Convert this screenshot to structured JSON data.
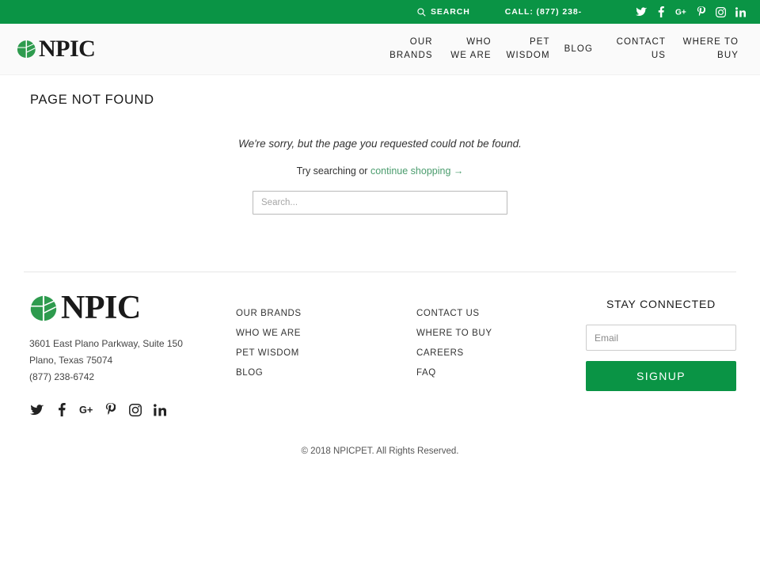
{
  "topbar": {
    "search_label": "SEARCH",
    "phone_label": "CALL: (877) 238-",
    "social": [
      {
        "name": "twitter-icon",
        "label": "Twitter"
      },
      {
        "name": "facebook-icon",
        "label": "Facebook"
      },
      {
        "name": "google-plus-icon",
        "label": "Google Plus"
      },
      {
        "name": "pinterest-icon",
        "label": "Pinterest"
      },
      {
        "name": "instagram-icon",
        "label": "Instagram"
      },
      {
        "name": "linkedin-icon",
        "label": "LinkedIn"
      }
    ]
  },
  "header": {
    "logo_text": "NPIC",
    "nav": [
      {
        "label": "OUR BRANDS"
      },
      {
        "label": "WHO WE ARE"
      },
      {
        "label": "PET WISDOM"
      },
      {
        "label": "BLOG"
      },
      {
        "label": "CONTACT US"
      },
      {
        "label": "WHERE TO BUY"
      }
    ]
  },
  "main": {
    "page_title": "PAGE NOT FOUND",
    "message": "We're sorry, but the page you requested could not be found.",
    "try_prefix": "Try searching or ",
    "continue_link": "continue shopping →",
    "search_placeholder": "Search...",
    "search_value": ""
  },
  "footer": {
    "logo_text": "NPIC",
    "address_line1": "3601 East Plano Parkway, Suite 150",
    "address_line2": "Plano, Texas 75074",
    "phone": "(877) 238-6742",
    "links_col1": [
      {
        "label": "OUR BRANDS"
      },
      {
        "label": "WHO WE ARE"
      },
      {
        "label": "PET WISDOM"
      },
      {
        "label": "BLOG"
      }
    ],
    "links_col2": [
      {
        "label": "CONTACT US"
      },
      {
        "label": "WHERE TO BUY"
      },
      {
        "label": "CAREERS"
      },
      {
        "label": "FAQ"
      }
    ],
    "social": [
      {
        "name": "twitter-icon",
        "label": "Twitter"
      },
      {
        "name": "facebook-icon",
        "label": "Facebook"
      },
      {
        "name": "google-plus-icon",
        "label": "Google Plus"
      },
      {
        "name": "pinterest-icon",
        "label": "Pinterest"
      },
      {
        "name": "instagram-icon",
        "label": "Instagram"
      },
      {
        "name": "linkedin-icon",
        "label": "LinkedIn"
      }
    ],
    "newsletter_title": "STAY CONNECTED",
    "email_placeholder": "Email",
    "email_value": "",
    "signup_label": "SIGNUP",
    "copyright": "© 2018 NPICPET. All Rights Reserved."
  },
  "colors": {
    "brand_green": "#0a9445",
    "link_green": "#4a9c6d",
    "header_bg": "#fafafa",
    "text_dark": "#1a1a1a"
  }
}
